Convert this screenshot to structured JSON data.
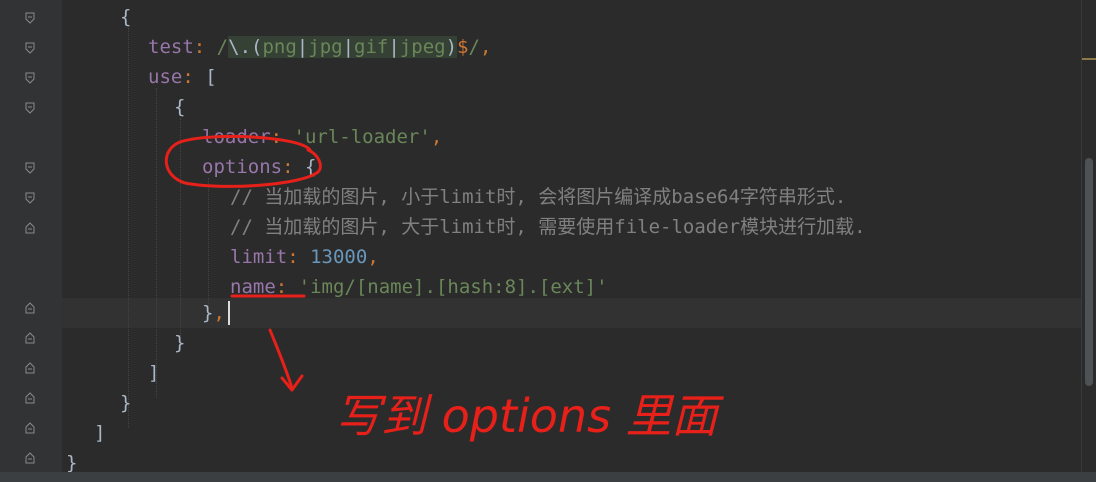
{
  "editor": {
    "lines": {
      "l1": {
        "brace": "{"
      },
      "l2": {
        "key": "test",
        "colon": ":",
        "slash_open": "/",
        "escape": "\\.",
        "lparen": "(",
        "alt1": "png",
        "pipe1": "|",
        "alt2": "jpg",
        "pipe2": "|",
        "alt3": "gif",
        "pipe3": "|",
        "alt4": "jpeg",
        "rparen": ")",
        "anchor": "$",
        "slash_close": "/",
        "comma": ","
      },
      "l3": {
        "key": "use",
        "colon": ":",
        "bracket": "["
      },
      "l4": {
        "brace": "{"
      },
      "l5": {
        "key": "loader",
        "colon": ":",
        "value": "'url-loader'",
        "comma": ","
      },
      "l6": {
        "key": "options",
        "colon": ":",
        "brace": "{"
      },
      "l7": {
        "comment": "// 当加载的图片, 小于limit时, 会将图片编译成base64字符串形式."
      },
      "l8": {
        "comment": "// 当加载的图片, 大于limit时, 需要使用file-loader模块进行加载."
      },
      "l9": {
        "key": "limit",
        "colon": ":",
        "value": "13000",
        "comma": ","
      },
      "l10": {
        "key": "name",
        "colon": ":",
        "value": "'img/[name].[hash:8].[ext]'"
      },
      "l11": {
        "brace": "}",
        "comma": ","
      },
      "l12": {
        "brace": "}"
      },
      "l13": {
        "bracket": "]"
      },
      "l14": {
        "brace": "}"
      },
      "l15": {
        "bracket": "]"
      },
      "l16": {
        "brace": "}"
      }
    }
  },
  "annotation": {
    "handwritten_note": "写到 options 里面",
    "color": "#e8201a"
  },
  "colors": {
    "background": "#2b2b2b",
    "gutter": "#313335",
    "property": "#9876aa",
    "keyword_punct": "#cc7832",
    "string": "#6a8759",
    "number": "#6897bb",
    "comment": "#808080",
    "plain": "#a9b7c6"
  }
}
